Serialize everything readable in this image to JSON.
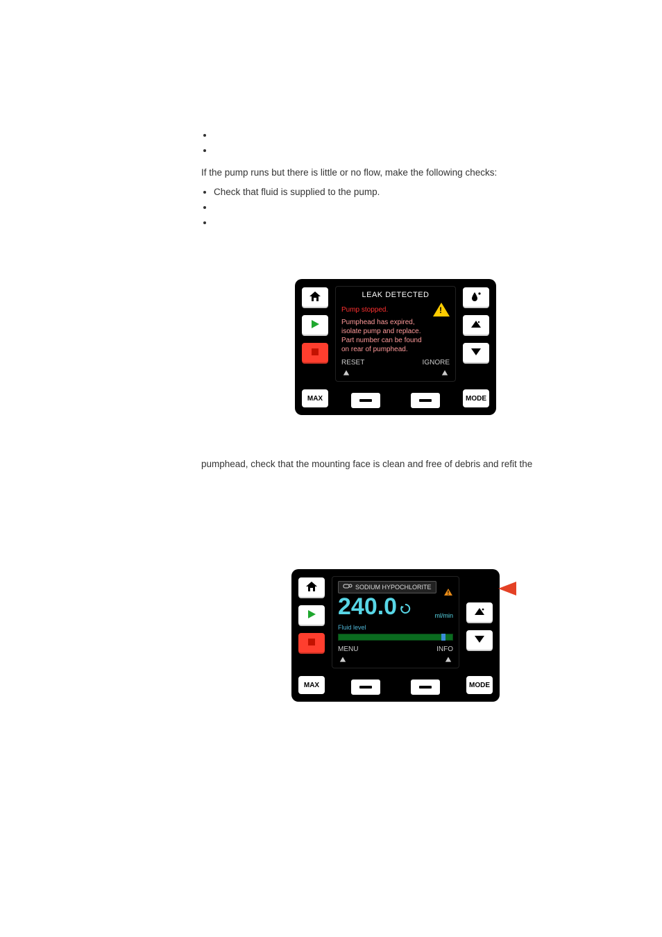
{
  "checks_top": [
    "",
    ""
  ],
  "intro_line": "If the pump runs but there is little or no flow, make the following checks:",
  "checks_mid": [
    "Check that fluid is supplied to the pump.",
    "",
    ""
  ],
  "screen1": {
    "title": "LEAK DETECTED",
    "status": "Pump stopped.",
    "body": [
      "Pumphead has expired,",
      "isolate pump and replace.",
      "Part number can be found",
      "on rear of pumphead."
    ],
    "left_action": "RESET",
    "right_action": "IGNORE",
    "btn_max": "MAX",
    "btn_mode": "MODE"
  },
  "fragment_line": "pumphead, check that the mounting face is clean and free of debris and refit the",
  "screen2": {
    "chem_label": "SODIUM HYPOCHLORITE",
    "value": "240.0",
    "unit": "ml/min",
    "fluid_level_label": "Fluid level",
    "menu_left": "MENU",
    "menu_right": "INFO",
    "btn_max": "MAX",
    "btn_mode": "MODE"
  }
}
